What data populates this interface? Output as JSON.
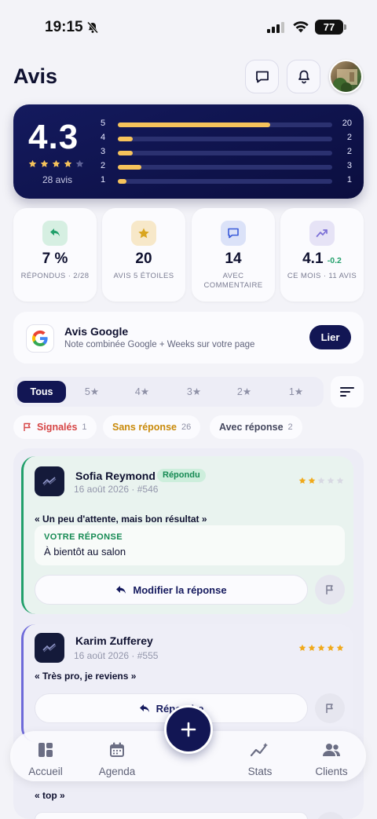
{
  "status_bar": {
    "time": "19:15",
    "battery": "77"
  },
  "header": {
    "title": "Avis"
  },
  "rating_summary": {
    "average": "4.3",
    "stars_filled": 4,
    "stars_total": 5,
    "review_count_label": "28 avis",
    "distribution": [
      {
        "star": "5",
        "count": "20",
        "fraction": 0.71
      },
      {
        "star": "4",
        "count": "2",
        "fraction": 0.07
      },
      {
        "star": "3",
        "count": "2",
        "fraction": 0.07
      },
      {
        "star": "2",
        "count": "3",
        "fraction": 0.11
      },
      {
        "star": "1",
        "count": "1",
        "fraction": 0.04
      }
    ]
  },
  "stats": [
    {
      "value": "7 %",
      "label": "RÉPONDUS · 2/28",
      "icon": "reply-icon",
      "color": "#22a06b"
    },
    {
      "value": "20",
      "label": "AVIS 5 ÉTOILES",
      "icon": "star-icon",
      "color": "#d9a520"
    },
    {
      "value": "14",
      "label": "AVEC COMMENTAIRE",
      "icon": "comment-icon",
      "color": "#3a5bd9"
    },
    {
      "value": "4.1",
      "delta": "-0.2",
      "label": "CE MOIS · 11 AVIS",
      "icon": "trend-up-icon",
      "color": "#7b6fd6"
    }
  ],
  "google": {
    "title": "Avis Google",
    "subtitle": "Note combinée Google + Weeks sur votre page",
    "link_label": "Lier"
  },
  "filters": {
    "tabs": [
      "Tous",
      "5★",
      "4★",
      "3★",
      "2★",
      "1★"
    ],
    "active": "Tous",
    "chips": [
      {
        "label": "Signalés",
        "count": "1",
        "color": "#d64545"
      },
      {
        "label": "Sans réponse",
        "count": "26",
        "color": "#c98a0a"
      },
      {
        "label": "Avec réponse",
        "count": "2",
        "color": "#44475e"
      }
    ]
  },
  "reviews": [
    {
      "name": "Sofia Reymond",
      "badge": "Répondu",
      "meta": "16 août 2026 · #546",
      "rating": 2,
      "text": "« Un peu d'attente, mais bon résultat »",
      "reply_label": "VOTRE RÉPONSE",
      "reply_text": "À bientôt au salon",
      "action_label": "Modifier la réponse"
    },
    {
      "name": "Karim Zufferey",
      "meta": "16 août 2026 · #555",
      "rating": 5,
      "text": "« Très pro, je reviens »",
      "action_label": "Répondre"
    },
    {
      "text": "« top »"
    }
  ],
  "nav": {
    "items": [
      "Accueil",
      "Agenda",
      "Stats",
      "Clients"
    ],
    "icons": [
      "home-icon",
      "calendar-icon",
      "stats-icon",
      "clients-icon"
    ]
  },
  "colors": {
    "primary": "#121654",
    "gold": "#f6c35b",
    "green": "#22a06b"
  }
}
